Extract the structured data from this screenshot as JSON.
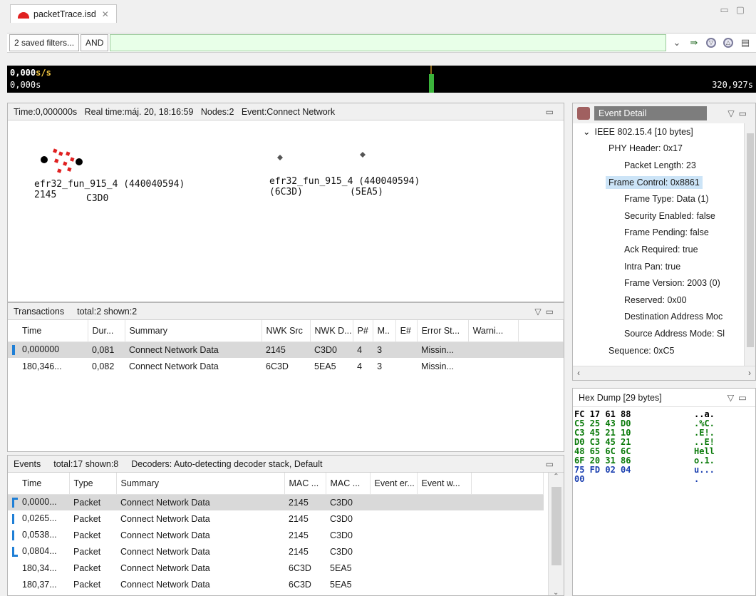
{
  "editor_tab": {
    "title": "packetTrace.isd",
    "close": "✕"
  },
  "filter_bar": {
    "saved_filters": "2 saved filters...",
    "operator": "AND",
    "value": ""
  },
  "timeline": {
    "rate": "0,000s/s",
    "rate_num": "0,000",
    "rate_unit": "s/s",
    "start": "0,000s",
    "end": "320,927s"
  },
  "network": {
    "header": "Time:0,000000s   Real time:máj. 20, 18:16:59   Nodes:2   Event:Connect Network",
    "node1": {
      "name": "efr32_fun_915_4 (440040594)",
      "id": "2145",
      "addr": "C3D0"
    },
    "node2": {
      "name": "efr32_fun_915_4 (440040594)",
      "left": "(6C3D)",
      "right": "(5EA5)"
    }
  },
  "transactions": {
    "title": "Transactions",
    "stats": "total:2 shown:2",
    "columns": [
      "Time",
      "Dur...",
      "Summary",
      "NWK Src",
      "NWK D...",
      "P#",
      "M..",
      "E#",
      "Error St...",
      "Warni..."
    ],
    "rows": [
      [
        "0,000000",
        "0,081",
        "Connect Network Data",
        "2145",
        "C3D0",
        "4",
        "3",
        "",
        "Missin...",
        ""
      ],
      [
        "180,346...",
        "0,082",
        "Connect Network Data",
        "6C3D",
        "5EA5",
        "4",
        "3",
        "",
        "Missin...",
        ""
      ]
    ]
  },
  "events": {
    "title": "Events",
    "stats": "total:17 shown:8",
    "decoders": "Decoders: Auto-detecting decoder stack, Default",
    "columns": [
      "Time",
      "Type",
      "Summary",
      "MAC ...",
      "MAC ...",
      "Event er...",
      "Event w..."
    ],
    "rows": [
      [
        "0,0000...",
        "Packet",
        "Connect Network Data",
        "2145",
        "C3D0",
        "",
        ""
      ],
      [
        "0,0265...",
        "Packet",
        "Connect Network Data",
        "2145",
        "C3D0",
        "",
        ""
      ],
      [
        "0,0538...",
        "Packet",
        "Connect Network Data",
        "2145",
        "C3D0",
        "",
        ""
      ],
      [
        "0,0804...",
        "Packet",
        "Connect Network Data",
        "2145",
        "C3D0",
        "",
        ""
      ],
      [
        "180,34...",
        "Packet",
        "Connect Network Data",
        "6C3D",
        "5EA5",
        "",
        ""
      ],
      [
        "180,37...",
        "Packet",
        "Connect Network Data",
        "6C3D",
        "5EA5",
        "",
        ""
      ]
    ]
  },
  "event_detail": {
    "title": "Event Detail",
    "items": [
      "IEEE 802.15.4 [10 bytes]",
      "PHY Header: 0x17",
      "Packet Length: 23",
      "Frame Control: 0x8861",
      "Frame Type: Data (1)",
      "Security Enabled: false",
      "Frame Pending: false",
      "Ack Required: true",
      "Intra Pan: true",
      "Frame Version: 2003 (0)",
      "Reserved: 0x00",
      "Destination Address Moc",
      "Source Address Mode: Sl",
      "Sequence: 0xC5"
    ]
  },
  "hex_dump": {
    "title": "Hex Dump [29 bytes]",
    "rows": [
      {
        "bytes": "FC 17 61 88",
        "ascii": "..a."
      },
      {
        "bytes": "C5 25 43 D0",
        "ascii": ".%C."
      },
      {
        "bytes": "C3 45 21 10",
        "ascii": ".E!."
      },
      {
        "bytes": "D0 C3 45 21",
        "ascii": "..E!"
      },
      {
        "bytes": "48 65 6C 6C",
        "ascii": "Hell"
      },
      {
        "bytes": "6F 20 31 86",
        "ascii": "o.1."
      },
      {
        "bytes": "75 FD 02 04",
        "ascii": "u..."
      },
      {
        "bytes": "00",
        "ascii": "."
      }
    ]
  },
  "colors": {
    "accent_blue": "#1f7fd6",
    "selection_blue": "#cce4f7",
    "filter_green": "#e8ffe8",
    "node_red": "#e02020"
  }
}
